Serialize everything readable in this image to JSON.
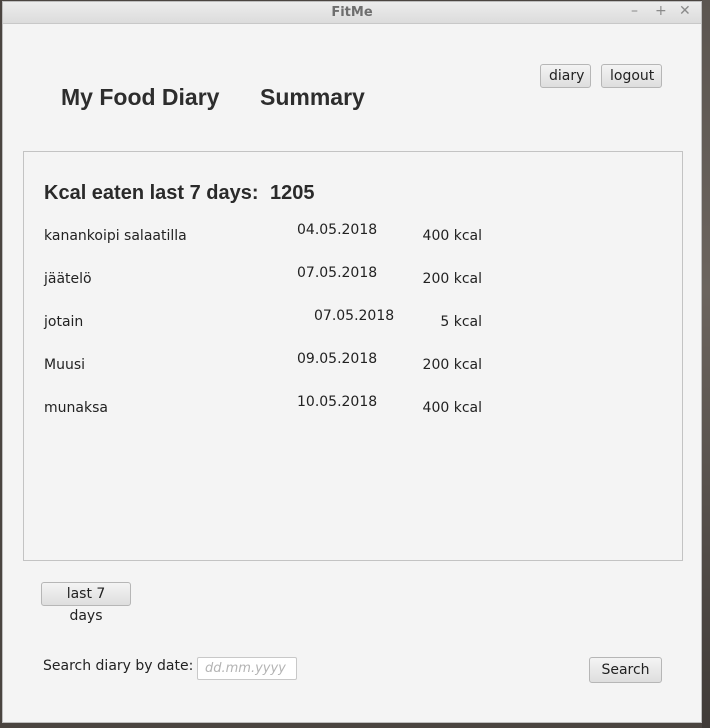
{
  "window": {
    "title": "FitMe",
    "minimize": "–",
    "maximize": "+",
    "close": "✕"
  },
  "nav": {
    "diary_title": "My Food Diary",
    "summary_title": "Summary",
    "diary_button": "diary",
    "logout_button": "logout"
  },
  "summary": {
    "heading": "Kcal eaten last 7 days:",
    "total": "1205",
    "entries": [
      {
        "name": "kanankoipi salaatilla",
        "date": "04.05.2018",
        "kcal": "400 kcal"
      },
      {
        "name": "jäätelö",
        "date": "07.05.2018",
        "kcal": "200 kcal"
      },
      {
        "name": "jotain",
        "date": "07.05.2018",
        "kcal": "5 kcal"
      },
      {
        "name": "Muusi",
        "date": "09.05.2018",
        "kcal": "200 kcal"
      },
      {
        "name": "munaksa",
        "date": "10.05.2018",
        "kcal": "400 kcal"
      }
    ]
  },
  "controls": {
    "last7_button": "last 7 days",
    "search_label": "Search diary by date:",
    "search_placeholder": "dd.mm.yyyy",
    "search_value": "",
    "search_button": "Search"
  }
}
